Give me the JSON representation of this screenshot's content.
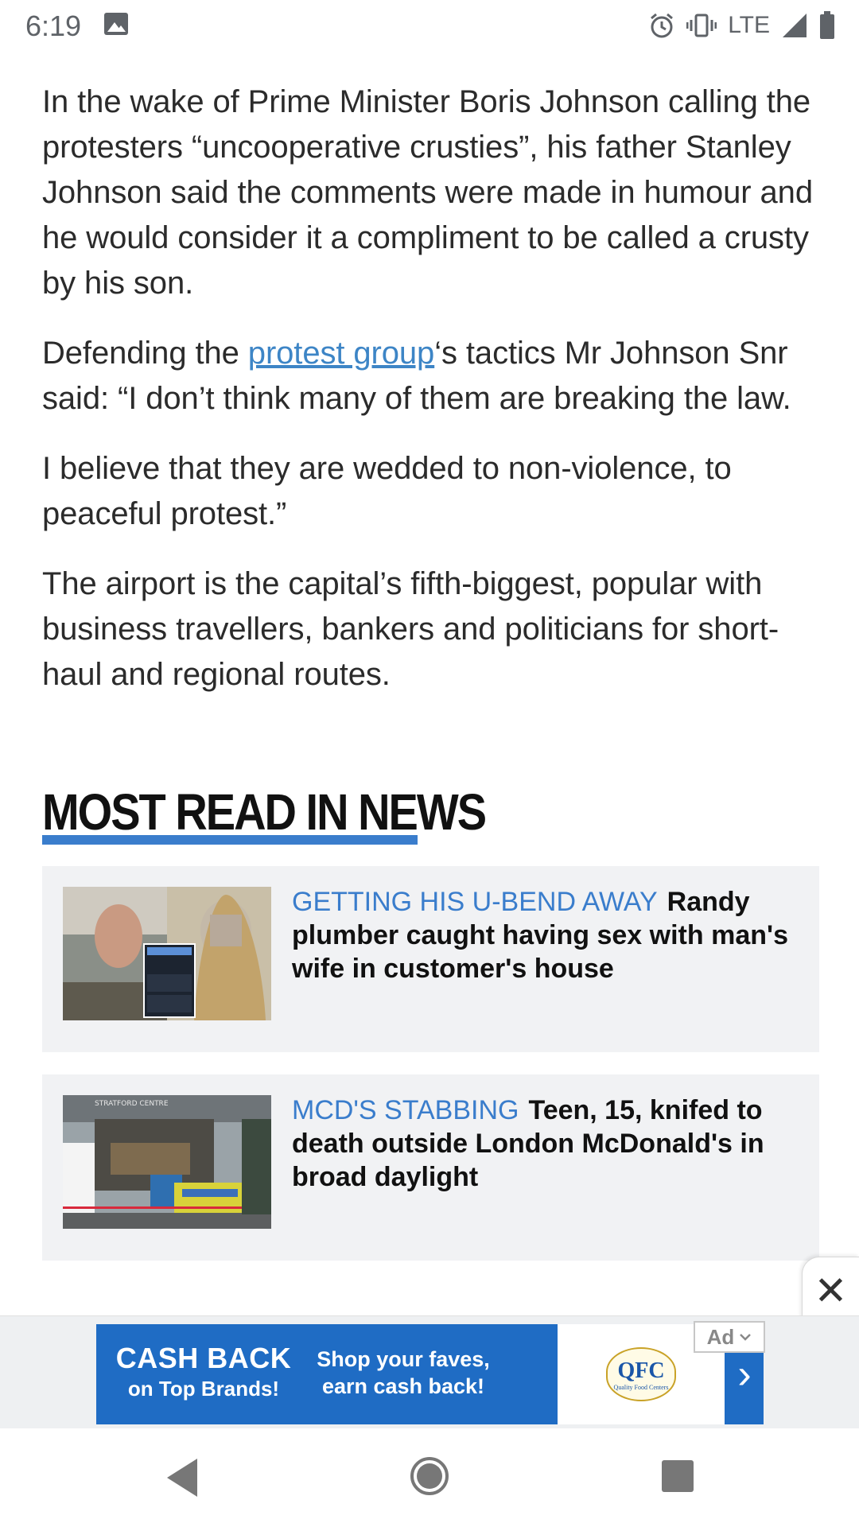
{
  "status_bar": {
    "time": "6:19",
    "network": "LTE",
    "icons": [
      "image-icon",
      "alarm-icon",
      "vibrate-icon",
      "signal-icon",
      "battery-icon"
    ]
  },
  "article": {
    "paragraphs": [
      "In the wake of Prime Minister Boris Johnson calling the protesters “uncooperative crusties”, his father Stanley Johnson said the comments were made in humour and he would consider it a compliment to be called a crusty by his son.",
      null,
      "I believe that they are wedded to non-violence, to peaceful protest.”",
      "The airport is the capital’s fifth-biggest, popular with business travellers, bankers and politicians for short-haul and regional routes."
    ],
    "para2_before": "Defending the ",
    "para2_link": "protest group",
    "para2_after": "‘s tactics Mr Johnson Snr said: “I don’t think many of them are breaking the law."
  },
  "most_read": {
    "title": "MOST READ IN NEWS",
    "accent_color": "#3a7dcc",
    "items": [
      {
        "kicker": "GETTING HIS U-BEND AWAY",
        "headline": "Randy plumber caught having sex with man's wife in customer's house"
      },
      {
        "kicker": "MCD'S STABBING",
        "headline": "Teen, 15, knifed to death outside London McDonald's in broad daylight",
        "image_sign_text": "STRATFORD CENTRE"
      }
    ]
  },
  "ad": {
    "cash_back": "CASH BACK",
    "on_top_brands": "on Top Brands!",
    "tagline_line1": "Shop your faves,",
    "tagline_line2": "earn cash back!",
    "logo_text": "QFC",
    "logo_subtext": "Quality Food Centers",
    "chip_label": "Ad",
    "close_label": "✕",
    "brand_color": "#1f6cc4"
  },
  "nav": {
    "icons": [
      "back-icon",
      "home-icon",
      "recents-icon"
    ]
  }
}
